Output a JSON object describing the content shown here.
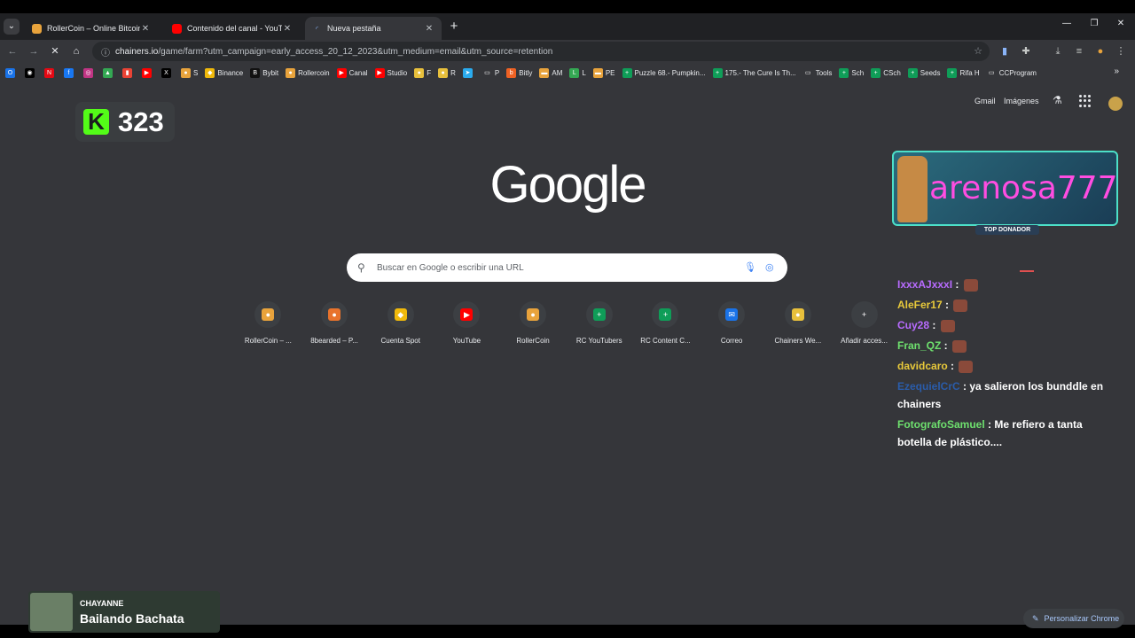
{
  "tabs": [
    {
      "title": "RollerCoin – Online Bitcoin Mining",
      "favicon_color": "#e8a33c"
    },
    {
      "title": "Contenido del canal - YouTube",
      "favicon_color": "#ff0000"
    },
    {
      "title": "Nueva pestaña",
      "favicon_color": "#35363a"
    }
  ],
  "tab_close": "✕",
  "newtab_label": "+",
  "address": {
    "domain": "chainers.io",
    "path": "/game/farm?utm_campaign=early_access_20_12_2023&utm_medium=email&utm_source=retention"
  },
  "bookmarks": [
    {
      "label": "",
      "color": "#1a73e8",
      "glyph": "O"
    },
    {
      "label": "",
      "color": "#000000",
      "glyph": "◉"
    },
    {
      "label": "",
      "color": "#e50914",
      "glyph": "N"
    },
    {
      "label": "",
      "color": "#1877f2",
      "glyph": "f"
    },
    {
      "label": "",
      "color": "#c13584",
      "glyph": "◎"
    },
    {
      "label": "",
      "color": "#34a853",
      "glyph": "▲"
    },
    {
      "label": "",
      "color": "#ea4335",
      "glyph": "▮"
    },
    {
      "label": "",
      "color": "#ff0000",
      "glyph": "▶"
    },
    {
      "label": "",
      "color": "#000000",
      "glyph": "X"
    },
    {
      "label": "S",
      "color": "#e8a33c",
      "glyph": "●"
    },
    {
      "label": "Binance",
      "color": "#f0b90b",
      "glyph": "◆"
    },
    {
      "label": "Bybit",
      "color": "#111111",
      "glyph": "B"
    },
    {
      "label": "Rollercoin",
      "color": "#e8a33c",
      "glyph": "●"
    },
    {
      "label": "Canal",
      "color": "#ff0000",
      "glyph": "▶"
    },
    {
      "label": "Studio",
      "color": "#ff0000",
      "glyph": "▶"
    },
    {
      "label": "F",
      "color": "#e8c03c",
      "glyph": "●"
    },
    {
      "label": "R",
      "color": "#e8c03c",
      "glyph": "●"
    },
    {
      "label": "",
      "color": "#2aabee",
      "glyph": "➤"
    },
    {
      "label": "P",
      "color": "#35363a",
      "glyph": "▭"
    },
    {
      "label": "Bitly",
      "color": "#ee6123",
      "glyph": "b"
    },
    {
      "label": "AM",
      "color": "#e8a33c",
      "glyph": "▬"
    },
    {
      "label": "L",
      "color": "#34a853",
      "glyph": "L"
    },
    {
      "label": "PE",
      "color": "#e8a33c",
      "glyph": "▬"
    },
    {
      "label": "Puzzle 68.- Pumpkin...",
      "color": "#0f9d58",
      "glyph": "+"
    },
    {
      "label": "175.- The Cure Is Th...",
      "color": "#0f9d58",
      "glyph": "+"
    },
    {
      "label": "Tools",
      "color": "#35363a",
      "glyph": "▭"
    },
    {
      "label": "Sch",
      "color": "#0f9d58",
      "glyph": "+"
    },
    {
      "label": "CSch",
      "color": "#0f9d58",
      "glyph": "+"
    },
    {
      "label": "Seeds",
      "color": "#0f9d58",
      "glyph": "+"
    },
    {
      "label": "Rifa H",
      "color": "#0f9d58",
      "glyph": "+"
    },
    {
      "label": "CCProgram",
      "color": "#35363a",
      "glyph": "▭"
    }
  ],
  "bookmarks_more": "»",
  "google": {
    "gmail": "Gmail",
    "images": "Imágenes",
    "logo": "Google",
    "search_placeholder": "Buscar en Google o escribir una URL"
  },
  "shortcuts": [
    {
      "label": "RollerCoin – ...",
      "color": "#e8a33c",
      "glyph": "●"
    },
    {
      "label": "8bearded – P...",
      "color": "#e8732c",
      "glyph": "●"
    },
    {
      "label": "Cuenta Spot",
      "color": "#f0b90b",
      "glyph": "◆"
    },
    {
      "label": "YouTube",
      "color": "#ff0000",
      "glyph": "▶"
    },
    {
      "label": "RollerCoin",
      "color": "#e8a33c",
      "glyph": "●"
    },
    {
      "label": "RC YouTubers",
      "color": "#0f9d58",
      "glyph": "+"
    },
    {
      "label": "RC Content C...",
      "color": "#0f9d58",
      "glyph": "+"
    },
    {
      "label": "Correo",
      "color": "#1a73e8",
      "glyph": "✉"
    },
    {
      "label": "Chainers We...",
      "color": "#e8c03c",
      "glyph": "●"
    },
    {
      "label": "Añadir acces...",
      "color": "#3c3f43",
      "glyph": "+"
    }
  ],
  "kick": {
    "logo": "K",
    "count": "323"
  },
  "donor": {
    "name": "arenosa777",
    "tag": "TOP DONADOR"
  },
  "chat": [
    {
      "user": "IxxxAJxxxI",
      "color": "#b86bff",
      "text": ""
    },
    {
      "user": "AleFer17",
      "color": "#e8c93a",
      "text": ""
    },
    {
      "user": "Cuy28",
      "color": "#b86bff",
      "text": ""
    },
    {
      "user": "Fran_QZ",
      "color": "#6ee06e",
      "text": ""
    },
    {
      "user": "davidcaro",
      "color": "#e8c93a",
      "text": ""
    },
    {
      "user": "EzequielCrC",
      "color": "#2a5caa",
      "text": "ya salieron los bunddle en chainers"
    },
    {
      "user": "FotografoSamuel",
      "color": "#6ee06e",
      "text": "Me refiero a tanta botella de plástico...."
    }
  ],
  "now_playing": {
    "artist": "CHAYANNE",
    "song": "Bailando Bachata"
  },
  "customize": "Personalizar Chrome"
}
